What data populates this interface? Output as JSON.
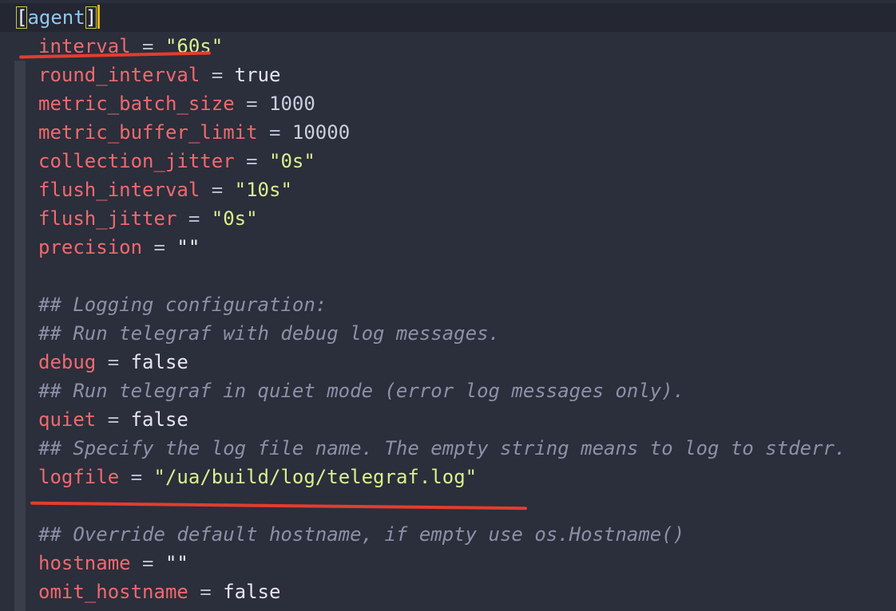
{
  "editor": {
    "header": {
      "open_bracket": "[",
      "name": "agent",
      "close_bracket": "]"
    },
    "lines": [
      {
        "key": "interval",
        "op": " = ",
        "value": "\"60s\""
      },
      {
        "key": "round_interval",
        "op": " = ",
        "value": "true"
      },
      {
        "key": "metric_batch_size",
        "op": " = ",
        "value": "1000"
      },
      {
        "key": "metric_buffer_limit",
        "op": " = ",
        "value": "10000"
      },
      {
        "key": "collection_jitter",
        "op": " = ",
        "value": "\"0s\""
      },
      {
        "key": "flush_interval",
        "op": " = ",
        "value": "\"10s\""
      },
      {
        "key": "flush_jitter",
        "op": " = ",
        "value": "\"0s\""
      },
      {
        "key": "precision",
        "op": " = ",
        "value": "\"\""
      },
      {
        "comment": "## Logging configuration:"
      },
      {
        "comment": "## Run telegraf with debug log messages."
      },
      {
        "key": "debug",
        "op": " = ",
        "value": "false"
      },
      {
        "comment": "## Run telegraf in quiet mode (error log messages only)."
      },
      {
        "key": "quiet",
        "op": " = ",
        "value": "false"
      },
      {
        "comment": "## Specify the log file name. The empty string means to log to stderr."
      },
      {
        "key": "logfile",
        "op": " = ",
        "value": "\"/ua/build/log/telegraf.log\""
      },
      {
        "comment": "## Override default hostname, if empty use os.Hostname()"
      },
      {
        "key": "hostname",
        "op": " = ",
        "value": "\"\""
      },
      {
        "key": "omit_hostname",
        "op": " = ",
        "value": "false"
      }
    ]
  },
  "colors": {
    "background": "#2b2e3b",
    "key": "#ef6a6e",
    "string": "#d9f08e",
    "comment": "#8b91a7",
    "annotation_mark": "#e33d2d",
    "cursor": "#e8b100"
  }
}
